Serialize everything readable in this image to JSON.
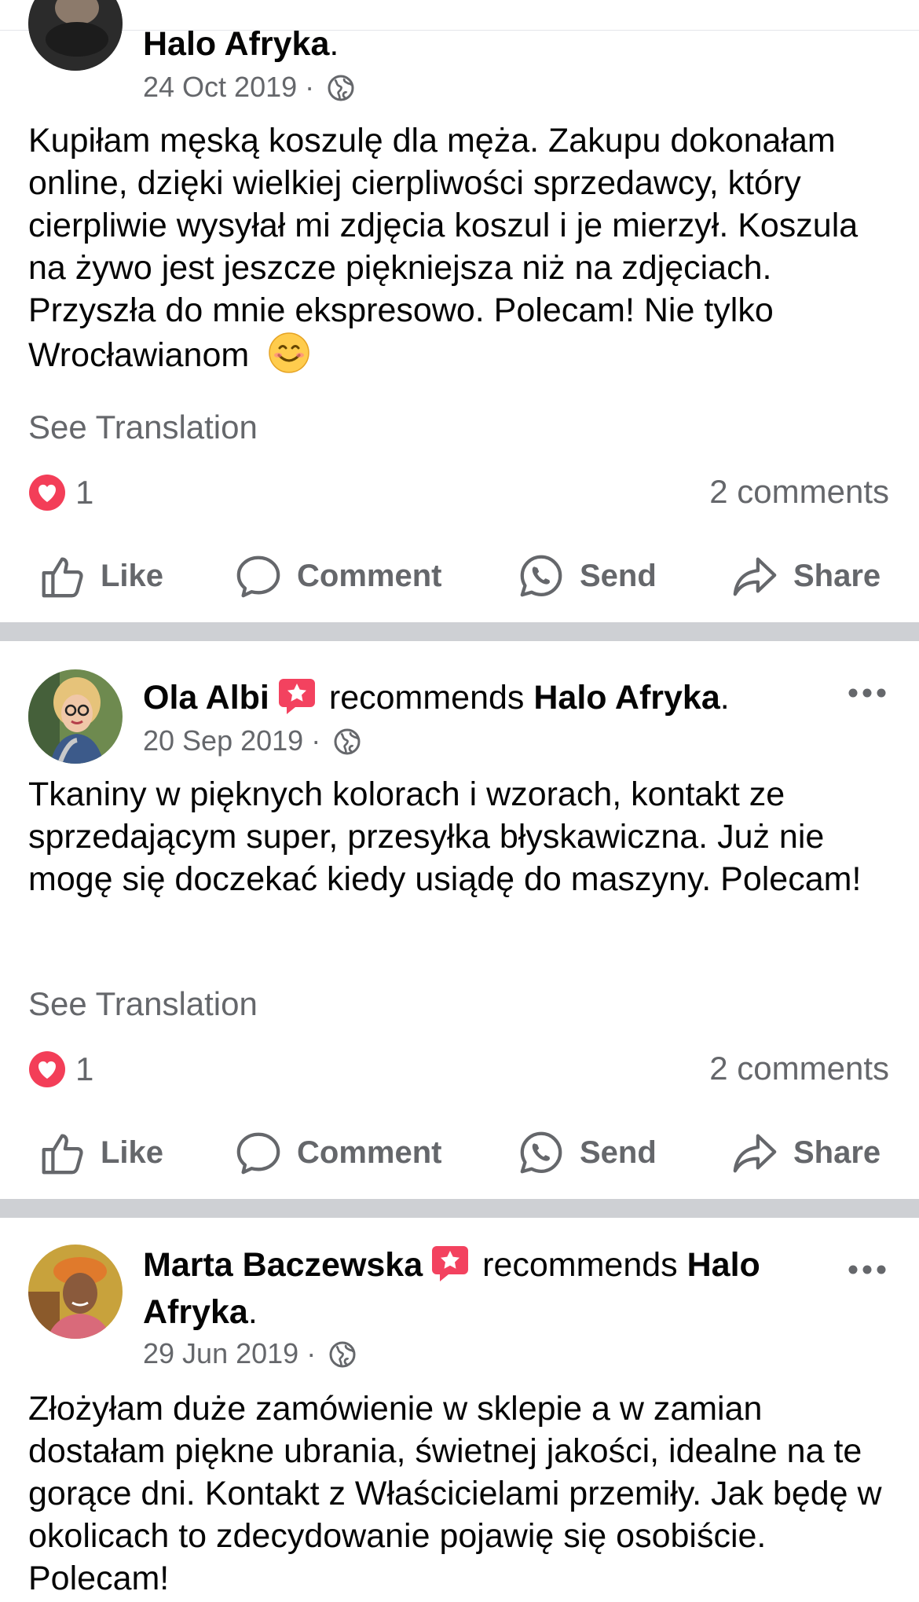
{
  "posts": [
    {
      "author": "",
      "recommends": "",
      "page": "Halo Afryka",
      "date": "24 Oct 2019",
      "text": "Kupiłam męską koszulę dla męża. Zakupu dokonałam online, dzięki wielkiej cierpliwości sprzedawcy, który cierpliwie wysyłał mi zdjęcia koszul i je mierzył. Koszula na żywo jest jeszcze piękniejsza niż na zdjęciach. Przyszła do mnie ekspresowo. Polecam! Nie tylko Wrocławianom",
      "see_translation": "See Translation",
      "reactions": "1",
      "comments": "2 comments"
    },
    {
      "author": "Ola Albi",
      "recommends": "recommends",
      "page": "Halo Afryka",
      "date": "20 Sep 2019",
      "text": "Tkaniny w pięknych kolorach i wzorach, kontakt ze sprzedającym super, przesyłka błyskawiczna. Już nie mogę się doczekać kiedy usiądę do maszyny. Polecam!",
      "see_translation": "See Translation",
      "reactions": "1",
      "comments": "2 comments"
    },
    {
      "author": "Marta Baczewska",
      "recommends": "recommends",
      "page_line1": "Halo",
      "page_line2": "Afryka",
      "date": "29 Jun 2019",
      "text": "Złożyłam duże zamówienie w sklepie a w zamian dostałam piękne ubrania, świetnej jakości, idealne na te gorące dni. Kontakt z Właścicielami przemiły. Jak będę w okolicach to zdecydowanie pojawię się osobiście. Polecam!"
    }
  ],
  "actions": {
    "like": "Like",
    "comment": "Comment",
    "send": "Send",
    "share": "Share"
  },
  "icons": [
    "globe-icon",
    "heart-reaction-icon",
    "like-icon",
    "comment-icon",
    "whatsapp-send-icon",
    "share-icon",
    "recommend-badge-icon",
    "more-options-icon"
  ],
  "colors": {
    "heart": "#f33e58",
    "badge": "#f3425f",
    "separator": "#ced0d4",
    "secondary_text": "#65676b"
  }
}
